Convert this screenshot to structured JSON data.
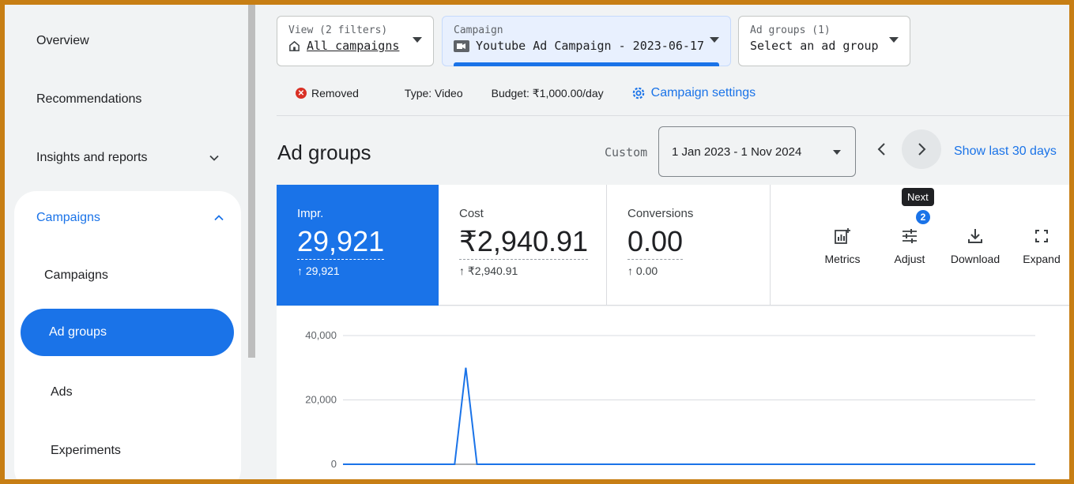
{
  "sidebar": {
    "items": [
      {
        "label": "Overview"
      },
      {
        "label": "Recommendations"
      },
      {
        "label": "Insights and reports"
      },
      {
        "label": "Campaigns"
      }
    ],
    "sub_items": [
      {
        "label": "Campaigns"
      },
      {
        "label": "Ad groups"
      },
      {
        "label": "Ads"
      },
      {
        "label": "Experiments"
      }
    ]
  },
  "filters": {
    "view": {
      "label": "View (2 filters)",
      "value": "All campaigns"
    },
    "campaign": {
      "label": "Campaign",
      "value": "Youtube Ad Campaign - 2023-06-17"
    },
    "ad_groups": {
      "label": "Ad groups (1)",
      "value": "Select an ad group"
    }
  },
  "info": {
    "status": "Removed",
    "type": "Type: Video",
    "budget": "Budget: ₹1,000.00/day",
    "settings": "Campaign settings"
  },
  "header": {
    "title": "Ad groups",
    "custom": "Custom",
    "date_range": "1 Jan 2023 - 1 Nov 2024",
    "show_last": "Show last 30 days",
    "tooltip": "Next"
  },
  "metrics": [
    {
      "label": "Impr.",
      "value": "29,921",
      "delta": "↑ 29,921"
    },
    {
      "label": "Cost",
      "value": "₹2,940.91",
      "delta": "↑ ₹2,940.91"
    },
    {
      "label": "Conversions",
      "value": "0.00",
      "delta": "↑ 0.00"
    }
  ],
  "tools": {
    "metrics": "Metrics",
    "adjust": "Adjust",
    "adjust_badge": "2",
    "download": "Download",
    "expand": "Expand"
  },
  "colors": {
    "accent": "#1a73e8",
    "frame": "#c77e14",
    "removed": "#d93025"
  },
  "chart_data": {
    "type": "line",
    "yticks": [
      "40,000",
      "20,000",
      "0"
    ],
    "ylim": [
      0,
      40000
    ],
    "series": [
      {
        "values": [
          0,
          0,
          0,
          0,
          0,
          0,
          0,
          0,
          0,
          0,
          0,
          30000,
          0,
          0,
          0,
          0,
          0,
          0,
          0,
          0,
          0,
          0,
          0,
          0,
          0,
          0,
          0,
          0,
          0,
          0,
          0,
          0,
          0,
          0,
          0,
          0,
          0,
          0,
          0,
          0,
          0,
          0,
          0,
          0,
          0,
          0,
          0,
          0,
          0,
          0,
          0,
          0,
          0,
          0,
          0,
          0,
          0,
          0,
          0,
          0,
          0,
          0,
          0
        ]
      }
    ]
  }
}
